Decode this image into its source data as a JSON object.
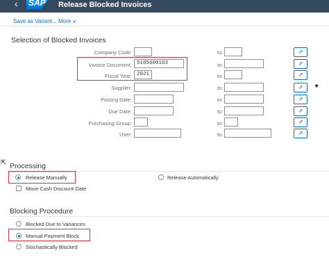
{
  "shell": {
    "title": "Release Blocked Invoices",
    "logo_text": "SAP"
  },
  "toolbar": {
    "save_variant": "Save as Variant...",
    "more": "More"
  },
  "selection": {
    "title": "Selection of Blocked Invoices",
    "to_label": "to:",
    "fields": [
      {
        "label": "Company Code:",
        "value": "",
        "to_value": ""
      },
      {
        "label": "Invoice Document:",
        "value": "5105600103",
        "to_value": ""
      },
      {
        "label": "Fiscal Year:",
        "value": "2021",
        "to_value": ""
      },
      {
        "label": "Supplier:",
        "value": "",
        "to_value": ""
      },
      {
        "label": "Posting Date:",
        "value": "",
        "to_value": ""
      },
      {
        "label": "Due Date:",
        "value": "",
        "to_value": ""
      },
      {
        "label": "Purchasing Group:",
        "value": "",
        "to_value": ""
      },
      {
        "label": "User:",
        "value": "",
        "to_value": ""
      }
    ]
  },
  "processing": {
    "title": "Processing",
    "release_manually": "Release Manually",
    "release_automatically": "Release Automatically",
    "move_cash_discount": "Move Cash Discount Date"
  },
  "blocking": {
    "title": "Blocking Procedure",
    "options": [
      "Blocked Due to Variances",
      "Manual Payment Block",
      "Stochastically Blocked"
    ]
  },
  "colors": {
    "shell_bg": "#354a5f",
    "accent": "#0a6ed1",
    "highlight": "#e0313a"
  }
}
